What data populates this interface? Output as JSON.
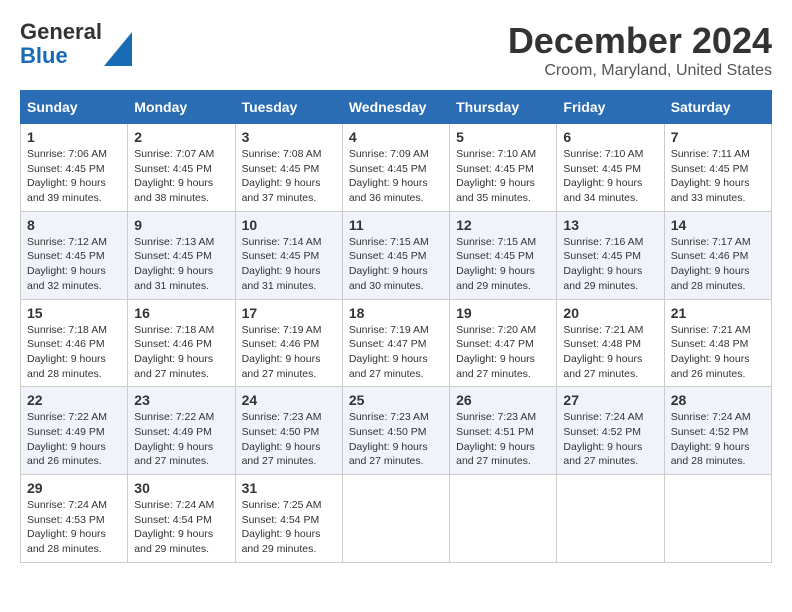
{
  "logo": {
    "line1": "General",
    "line2": "Blue"
  },
  "header": {
    "title": "December 2024",
    "subtitle": "Croom, Maryland, United States"
  },
  "days_of_week": [
    "Sunday",
    "Monday",
    "Tuesday",
    "Wednesday",
    "Thursday",
    "Friday",
    "Saturday"
  ],
  "weeks": [
    [
      {
        "day": 1,
        "sunrise": "7:06 AM",
        "sunset": "4:45 PM",
        "daylight": "9 hours and 39 minutes."
      },
      {
        "day": 2,
        "sunrise": "7:07 AM",
        "sunset": "4:45 PM",
        "daylight": "9 hours and 38 minutes."
      },
      {
        "day": 3,
        "sunrise": "7:08 AM",
        "sunset": "4:45 PM",
        "daylight": "9 hours and 37 minutes."
      },
      {
        "day": 4,
        "sunrise": "7:09 AM",
        "sunset": "4:45 PM",
        "daylight": "9 hours and 36 minutes."
      },
      {
        "day": 5,
        "sunrise": "7:10 AM",
        "sunset": "4:45 PM",
        "daylight": "9 hours and 35 minutes."
      },
      {
        "day": 6,
        "sunrise": "7:10 AM",
        "sunset": "4:45 PM",
        "daylight": "9 hours and 34 minutes."
      },
      {
        "day": 7,
        "sunrise": "7:11 AM",
        "sunset": "4:45 PM",
        "daylight": "9 hours and 33 minutes."
      }
    ],
    [
      {
        "day": 8,
        "sunrise": "7:12 AM",
        "sunset": "4:45 PM",
        "daylight": "9 hours and 32 minutes."
      },
      {
        "day": 9,
        "sunrise": "7:13 AM",
        "sunset": "4:45 PM",
        "daylight": "9 hours and 31 minutes."
      },
      {
        "day": 10,
        "sunrise": "7:14 AM",
        "sunset": "4:45 PM",
        "daylight": "9 hours and 31 minutes."
      },
      {
        "day": 11,
        "sunrise": "7:15 AM",
        "sunset": "4:45 PM",
        "daylight": "9 hours and 30 minutes."
      },
      {
        "day": 12,
        "sunrise": "7:15 AM",
        "sunset": "4:45 PM",
        "daylight": "9 hours and 29 minutes."
      },
      {
        "day": 13,
        "sunrise": "7:16 AM",
        "sunset": "4:45 PM",
        "daylight": "9 hours and 29 minutes."
      },
      {
        "day": 14,
        "sunrise": "7:17 AM",
        "sunset": "4:46 PM",
        "daylight": "9 hours and 28 minutes."
      }
    ],
    [
      {
        "day": 15,
        "sunrise": "7:18 AM",
        "sunset": "4:46 PM",
        "daylight": "9 hours and 28 minutes."
      },
      {
        "day": 16,
        "sunrise": "7:18 AM",
        "sunset": "4:46 PM",
        "daylight": "9 hours and 27 minutes."
      },
      {
        "day": 17,
        "sunrise": "7:19 AM",
        "sunset": "4:46 PM",
        "daylight": "9 hours and 27 minutes."
      },
      {
        "day": 18,
        "sunrise": "7:19 AM",
        "sunset": "4:47 PM",
        "daylight": "9 hours and 27 minutes."
      },
      {
        "day": 19,
        "sunrise": "7:20 AM",
        "sunset": "4:47 PM",
        "daylight": "9 hours and 27 minutes."
      },
      {
        "day": 20,
        "sunrise": "7:21 AM",
        "sunset": "4:48 PM",
        "daylight": "9 hours and 27 minutes."
      },
      {
        "day": 21,
        "sunrise": "7:21 AM",
        "sunset": "4:48 PM",
        "daylight": "9 hours and 26 minutes."
      }
    ],
    [
      {
        "day": 22,
        "sunrise": "7:22 AM",
        "sunset": "4:49 PM",
        "daylight": "9 hours and 26 minutes."
      },
      {
        "day": 23,
        "sunrise": "7:22 AM",
        "sunset": "4:49 PM",
        "daylight": "9 hours and 27 minutes."
      },
      {
        "day": 24,
        "sunrise": "7:23 AM",
        "sunset": "4:50 PM",
        "daylight": "9 hours and 27 minutes."
      },
      {
        "day": 25,
        "sunrise": "7:23 AM",
        "sunset": "4:50 PM",
        "daylight": "9 hours and 27 minutes."
      },
      {
        "day": 26,
        "sunrise": "7:23 AM",
        "sunset": "4:51 PM",
        "daylight": "9 hours and 27 minutes."
      },
      {
        "day": 27,
        "sunrise": "7:24 AM",
        "sunset": "4:52 PM",
        "daylight": "9 hours and 27 minutes."
      },
      {
        "day": 28,
        "sunrise": "7:24 AM",
        "sunset": "4:52 PM",
        "daylight": "9 hours and 28 minutes."
      }
    ],
    [
      {
        "day": 29,
        "sunrise": "7:24 AM",
        "sunset": "4:53 PM",
        "daylight": "9 hours and 28 minutes."
      },
      {
        "day": 30,
        "sunrise": "7:24 AM",
        "sunset": "4:54 PM",
        "daylight": "9 hours and 29 minutes."
      },
      {
        "day": 31,
        "sunrise": "7:25 AM",
        "sunset": "4:54 PM",
        "daylight": "9 hours and 29 minutes."
      },
      null,
      null,
      null,
      null
    ]
  ]
}
